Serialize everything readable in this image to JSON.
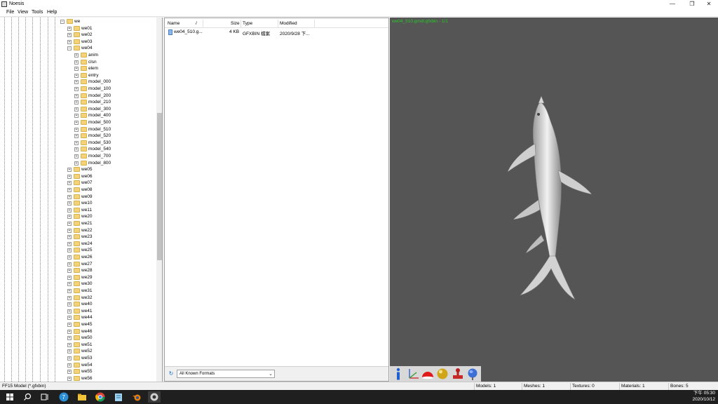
{
  "window": {
    "title": "Noesis",
    "buttons": [
      "—",
      "❐",
      "✕"
    ]
  },
  "menu": [
    "File",
    "View",
    "Tools",
    "Help"
  ],
  "tree": {
    "root_label": "we",
    "items": [
      {
        "label": "we01",
        "level": 1,
        "expander": "+"
      },
      {
        "label": "we02",
        "level": 1,
        "expander": "+"
      },
      {
        "label": "we03",
        "level": 1,
        "expander": "+"
      },
      {
        "label": "we04",
        "level": 1,
        "expander": "-"
      },
      {
        "label": "anim",
        "level": 2,
        "expander": "+"
      },
      {
        "label": "clsn",
        "level": 2,
        "expander": "+"
      },
      {
        "label": "elem",
        "level": 2,
        "expander": "+"
      },
      {
        "label": "entry",
        "level": 2,
        "expander": "+"
      },
      {
        "label": "model_000",
        "level": 2,
        "expander": "+"
      },
      {
        "label": "model_100",
        "level": 2,
        "expander": "+"
      },
      {
        "label": "model_200",
        "level": 2,
        "expander": "+"
      },
      {
        "label": "model_210",
        "level": 2,
        "expander": "+"
      },
      {
        "label": "model_300",
        "level": 2,
        "expander": "+"
      },
      {
        "label": "model_400",
        "level": 2,
        "expander": "+"
      },
      {
        "label": "model_500",
        "level": 2,
        "expander": "+"
      },
      {
        "label": "model_510",
        "level": 2,
        "expander": "+"
      },
      {
        "label": "model_520",
        "level": 2,
        "expander": "+"
      },
      {
        "label": "model_530",
        "level": 2,
        "expander": "+"
      },
      {
        "label": "model_540",
        "level": 2,
        "expander": "+"
      },
      {
        "label": "model_700",
        "level": 2,
        "expander": "+"
      },
      {
        "label": "model_800",
        "level": 2,
        "expander": "+"
      },
      {
        "label": "we05",
        "level": 1,
        "expander": "+"
      },
      {
        "label": "we06",
        "level": 1,
        "expander": "+"
      },
      {
        "label": "we07",
        "level": 1,
        "expander": "+"
      },
      {
        "label": "we08",
        "level": 1,
        "expander": "+"
      },
      {
        "label": "we09",
        "level": 1,
        "expander": "+"
      },
      {
        "label": "we10",
        "level": 1,
        "expander": "+"
      },
      {
        "label": "we11",
        "level": 1,
        "expander": "+"
      },
      {
        "label": "we20",
        "level": 1,
        "expander": "+"
      },
      {
        "label": "we21",
        "level": 1,
        "expander": "+"
      },
      {
        "label": "we22",
        "level": 1,
        "expander": "+"
      },
      {
        "label": "we23",
        "level": 1,
        "expander": "+"
      },
      {
        "label": "we24",
        "level": 1,
        "expander": "+"
      },
      {
        "label": "we25",
        "level": 1,
        "expander": "+"
      },
      {
        "label": "we26",
        "level": 1,
        "expander": "+"
      },
      {
        "label": "we27",
        "level": 1,
        "expander": "+"
      },
      {
        "label": "we28",
        "level": 1,
        "expander": "+"
      },
      {
        "label": "we29",
        "level": 1,
        "expander": "+"
      },
      {
        "label": "we30",
        "level": 1,
        "expander": "+"
      },
      {
        "label": "we31",
        "level": 1,
        "expander": "+"
      },
      {
        "label": "we32",
        "level": 1,
        "expander": "+"
      },
      {
        "label": "we40",
        "level": 1,
        "expander": "+"
      },
      {
        "label": "we41",
        "level": 1,
        "expander": "+"
      },
      {
        "label": "we44",
        "level": 1,
        "expander": "+"
      },
      {
        "label": "we45",
        "level": 1,
        "expander": "+"
      },
      {
        "label": "we46",
        "level": 1,
        "expander": "+"
      },
      {
        "label": "we50",
        "level": 1,
        "expander": "+"
      },
      {
        "label": "we51",
        "level": 1,
        "expander": "+"
      },
      {
        "label": "we52",
        "level": 1,
        "expander": "+"
      },
      {
        "label": "we53",
        "level": 1,
        "expander": "+"
      },
      {
        "label": "we54",
        "level": 1,
        "expander": "+"
      },
      {
        "label": "we55",
        "level": 1,
        "expander": "+"
      },
      {
        "label": "we56",
        "level": 1,
        "expander": "+"
      }
    ]
  },
  "file_list": {
    "columns": [
      "Name",
      "Size",
      "Type",
      "Modified"
    ],
    "sort_indicator": "/",
    "rows": [
      {
        "name": "we04_510.g...",
        "size": "4 KB",
        "type": "GFXBIN 檔案",
        "modified": "2020/9/28 下..."
      }
    ],
    "filter": "All Known Formats"
  },
  "viewport": {
    "label": "we04_510.gmdl.gfxbin - 1/1",
    "label_color": "#29c829",
    "background": "#555555",
    "tools": [
      "info-icon",
      "axes-icon",
      "red-dome-icon",
      "yellow-sphere-icon",
      "stamp-icon",
      "globe-icon"
    ]
  },
  "status": {
    "format": "FF15 Model (*.gfxbin)",
    "models": "Models: 1",
    "meshes": "Meshes: 1",
    "textures": "Textures: 0",
    "materials": "Materials: 1",
    "bones": "Bones: 5"
  },
  "taskbar": {
    "time": "下午 05:30",
    "date": "2020/10/12",
    "apps": [
      "start-icon",
      "search-icon",
      "task-view-icon",
      "app-7-icon",
      "file-explorer-icon",
      "chrome-icon",
      "notepad-icon",
      "blender-icon",
      "noesis-icon"
    ]
  }
}
